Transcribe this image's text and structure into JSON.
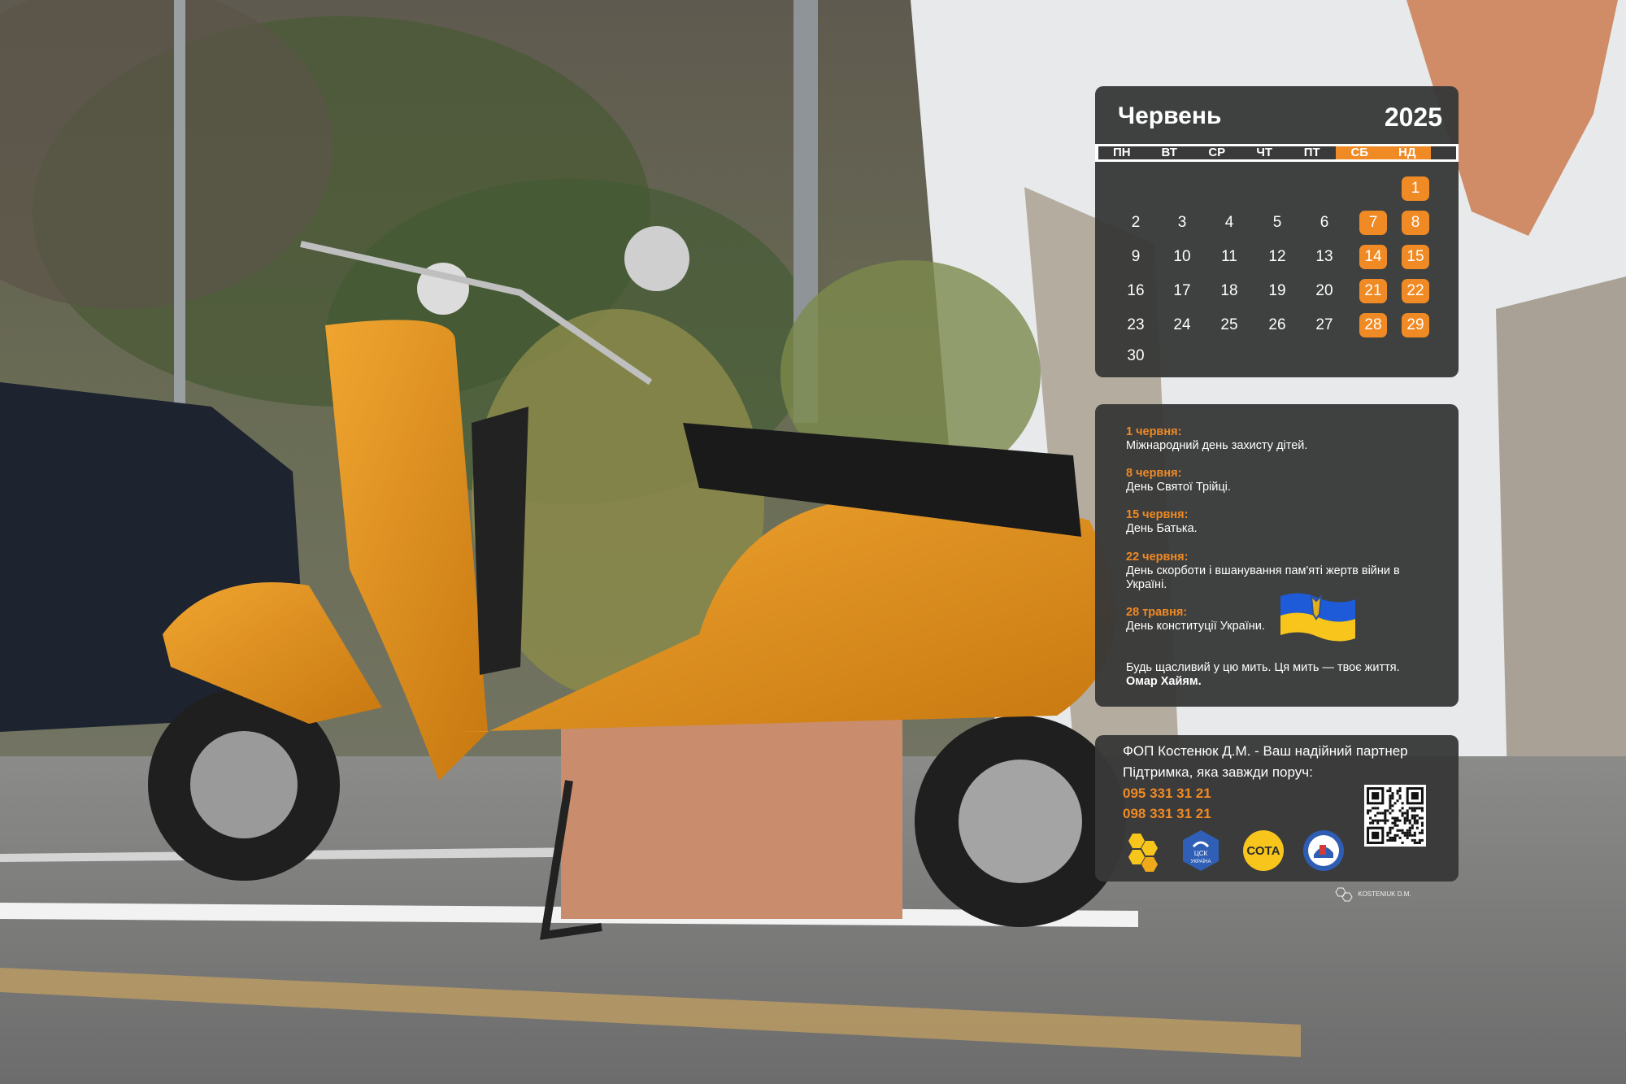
{
  "calendar": {
    "month": "Червень",
    "year": "2025",
    "weekdays": [
      "ПН",
      "ВТ",
      "СР",
      "ЧТ",
      "ПТ",
      "СБ",
      "НД"
    ],
    "weeks": [
      [
        "",
        "",
        "",
        "",
        "",
        "",
        "1"
      ],
      [
        "2",
        "3",
        "4",
        "5",
        "6",
        "7",
        "8"
      ],
      [
        "9",
        "10",
        "11",
        "12",
        "13",
        "14",
        "15"
      ],
      [
        "16",
        "17",
        "18",
        "19",
        "20",
        "21",
        "22"
      ],
      [
        "23",
        "24",
        "25",
        "26",
        "27",
        "28",
        "29"
      ],
      [
        "30",
        "",
        "",
        "",
        "",
        "",
        ""
      ]
    ],
    "accent_color": "#f08a24"
  },
  "holidays": [
    {
      "date": "1 червня:",
      "text": "Міжнародний день захисту дітей."
    },
    {
      "date": "8 червня:",
      "text": "День Святої Трійці."
    },
    {
      "date": "15 червня:",
      "text": "День Батька."
    },
    {
      "date": "22 червня:",
      "text": "День скорботи і вшанування пам'яті жертв війни в Україні."
    },
    {
      "date": "28 травня:",
      "text": "День конституції України."
    }
  ],
  "quote": {
    "text": "Будь щасливий у цю мить. Ця мить — твоє життя.",
    "author": "Омар Хайям."
  },
  "contact": {
    "company": "ФОП Костенюк Д.М. - Ваш надійний партнер",
    "tagline": "Підтримка, яка завжди поруч:",
    "phones": [
      "095 331 31 21",
      "098 331 31 21"
    ],
    "logos": [
      "honeycomb-logo",
      "csk-ukraine-logo",
      "sota-logo",
      "blue-badge-logo"
    ],
    "logo_labels": {
      "csk": "ЦСК УКРАЇНА",
      "sota": "СОТА"
    }
  },
  "brand": "KOSTENIUK D.M."
}
